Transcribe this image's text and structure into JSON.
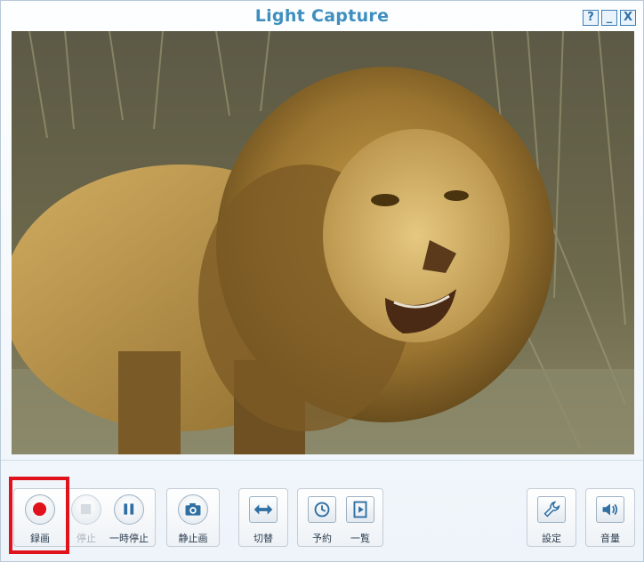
{
  "window": {
    "title": "Light Capture",
    "controls": {
      "help": "?",
      "minimize": "_",
      "close": "X"
    }
  },
  "video": {
    "subject": "lion"
  },
  "toolbar": {
    "record": {
      "label": "録画",
      "icon": "record-icon",
      "active": true
    },
    "stop": {
      "label": "停止",
      "icon": "stop-icon",
      "enabled": false
    },
    "pause": {
      "label": "一時停止",
      "icon": "pause-icon"
    },
    "snapshot": {
      "label": "静止画",
      "icon": "camera-icon"
    },
    "switch": {
      "label": "切替",
      "icon": "swap-arrows-icon"
    },
    "schedule": {
      "label": "予約",
      "icon": "clock-icon"
    },
    "list": {
      "label": "一覧",
      "icon": "playlist-icon"
    },
    "settings": {
      "label": "設定",
      "icon": "wrench-icon"
    },
    "volume": {
      "label": "音量",
      "icon": "speaker-icon"
    }
  },
  "colors": {
    "title": "#3e8fbf",
    "record": "#e0121c",
    "highlight": "#e0121c"
  }
}
